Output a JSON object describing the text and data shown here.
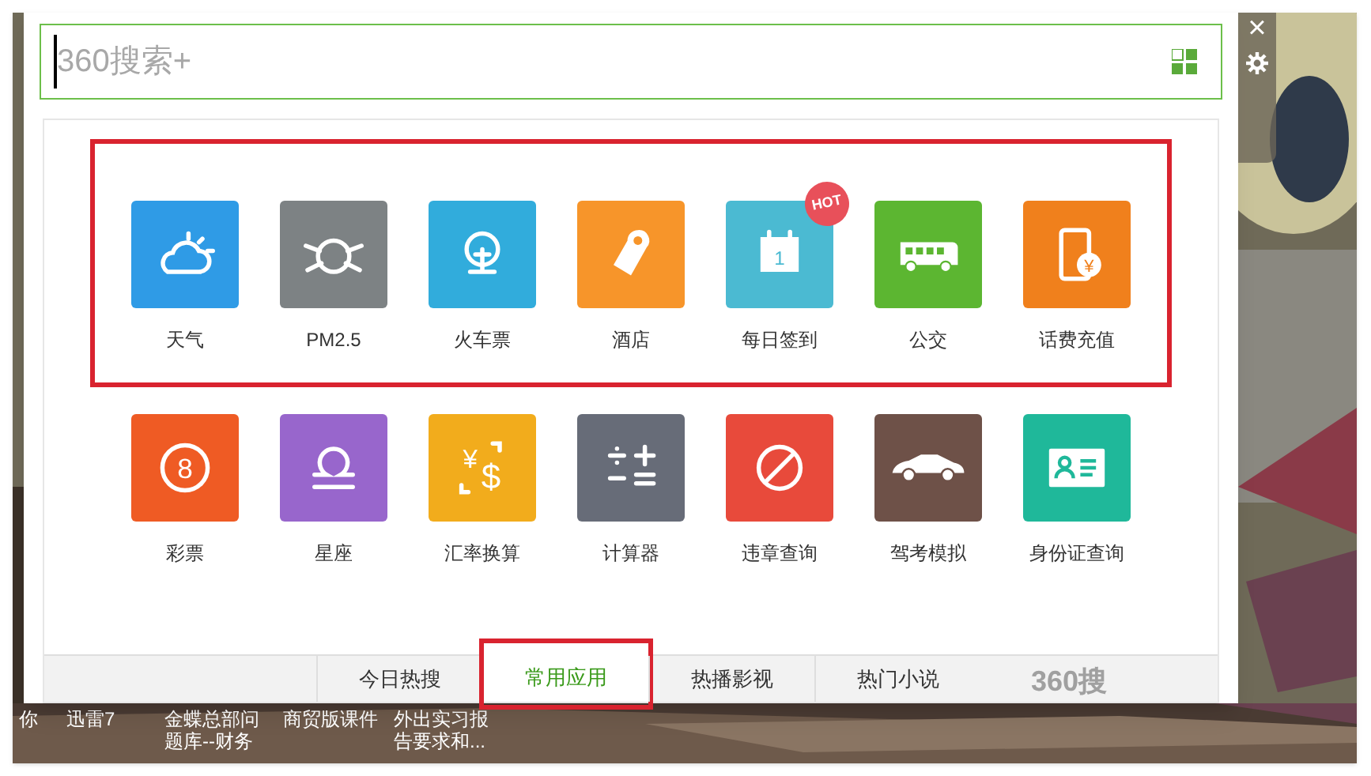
{
  "search": {
    "placeholder": "360搜索+"
  },
  "side_controls": [
    {
      "kind": "close",
      "label": "×"
    },
    {
      "kind": "settings"
    }
  ],
  "app_rows": [
    {
      "highlighted": true,
      "apps": [
        {
          "label": "天气",
          "color": "#2f9be6",
          "kind": "weather"
        },
        {
          "label": "PM2.5",
          "color": "#7d8284",
          "kind": "mask"
        },
        {
          "label": "火车票",
          "color": "#31acdc",
          "kind": "train"
        },
        {
          "label": "酒店",
          "color": "#f7952a",
          "kind": "hotel"
        },
        {
          "label": "每日签到",
          "color": "#4bbad2",
          "kind": "calendar",
          "icon_text": [
            "1"
          ],
          "badge": "HOT"
        },
        {
          "label": "公交",
          "color": "#5cb631",
          "kind": "bus"
        },
        {
          "label": "话费充值",
          "color": "#f0801c",
          "kind": "phone",
          "icon_text": [
            "¥"
          ]
        }
      ]
    },
    {
      "highlighted": false,
      "apps": [
        {
          "label": "彩票",
          "color": "#ef5b24",
          "kind": "lottery",
          "icon_text": [
            "8"
          ]
        },
        {
          "label": "星座",
          "color": "#9866cc",
          "kind": "libra"
        },
        {
          "label": "汇率换算",
          "color": "#f2ac1c",
          "kind": "exchange",
          "icon_text": [
            "¥",
            "$"
          ]
        },
        {
          "label": "计算器",
          "color": "#676c78",
          "kind": "calculator"
        },
        {
          "label": "违章查询",
          "color": "#e84a3b",
          "kind": "forbidden"
        },
        {
          "label": "驾考模拟",
          "color": "#6e5148",
          "kind": "car"
        },
        {
          "label": "身份证查询",
          "color": "#1fb89a",
          "kind": "idcard"
        }
      ]
    }
  ],
  "tabs": [
    {
      "label": "今日热搜",
      "selected": false,
      "highlighted": false
    },
    {
      "label": "常用应用",
      "selected": true,
      "highlighted": true
    },
    {
      "label": "热播影视",
      "selected": false,
      "highlighted": false
    },
    {
      "label": "热门小说",
      "selected": false,
      "highlighted": false
    }
  ],
  "footer_logo": "360搜",
  "desktop_icons": [
    {
      "label": "你"
    },
    {
      "label": "迅雷7"
    },
    {
      "label": "金蝶总部问题库--财务"
    },
    {
      "label": "商贸版课件"
    },
    {
      "label": "外出实习报告要求和..."
    }
  ]
}
